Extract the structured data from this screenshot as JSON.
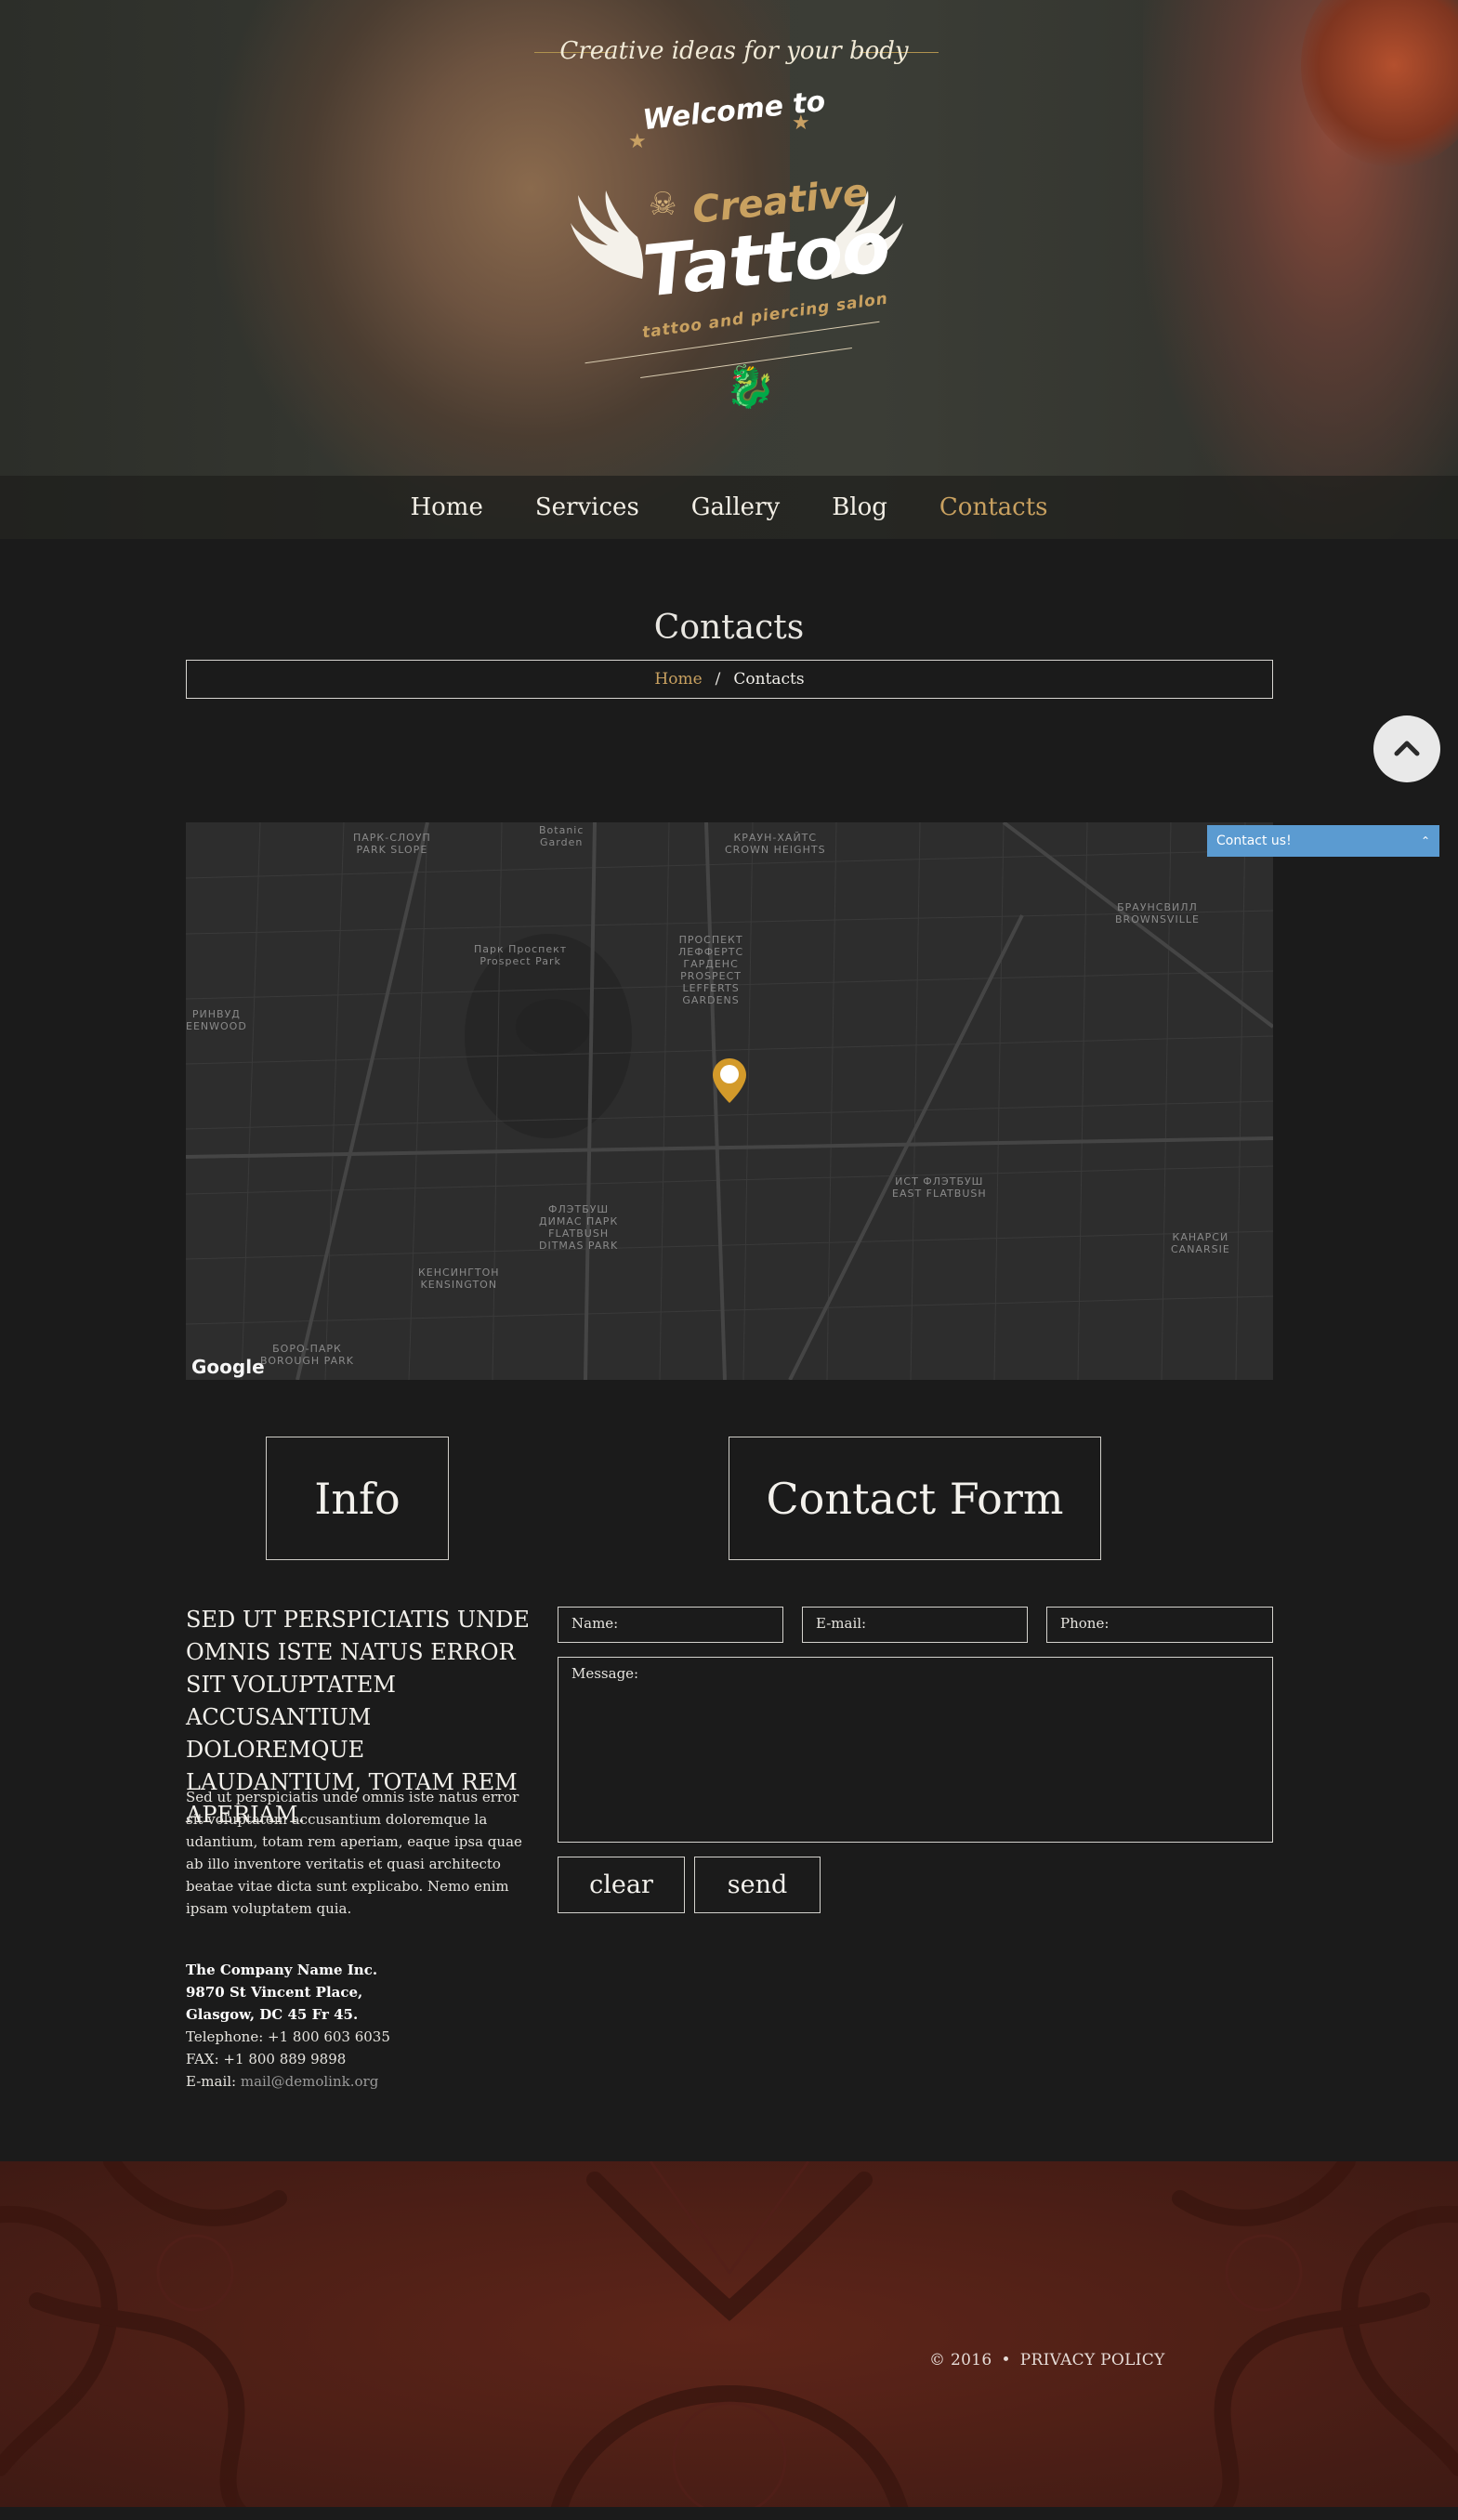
{
  "header": {
    "tagline": "Creative ideas for your body",
    "welcome": "Welcome to",
    "logo": {
      "creative": "Creative",
      "tattoo": "Tattoo",
      "subtitle": "tattoo and piercing salon"
    }
  },
  "nav": {
    "items": [
      {
        "label": "Home",
        "active": false
      },
      {
        "label": "Services",
        "active": false
      },
      {
        "label": "Gallery",
        "active": false
      },
      {
        "label": "Blog",
        "active": false
      },
      {
        "label": "Contacts",
        "active": true
      }
    ]
  },
  "page": {
    "title": "Contacts",
    "breadcrumb": {
      "home": "Home",
      "separator": "/",
      "current": "Contacts"
    }
  },
  "widgets": {
    "contact_us": "Contact us!"
  },
  "map": {
    "brand": "Google",
    "labels": [
      "ПАРК-СЛОУП\nPARK SLOPE",
      "Botanic\nGarden",
      "КРАУН-ХАЙТС\nCROWN HEIGHTS",
      "БРАУНСВИЛЛ\nBROWNSVILLE",
      "Парк Проспект\nProspect Park",
      "ПРОСПЕКТ\nЛЕФФЕРТС\nГАРДЕНС\nPROSPECT\nLEFFERTS\nGARDENS",
      "РИНВУД\nEENWOOD",
      "ФЛЭТБУШ\nДИМАС ПАРК\nFLATBUSH\nDITMAS PARK",
      "ИСТ ФЛЭТБУШ\nEAST FLATBUSH",
      "КАНАРСИ\nCANARSIE",
      "КЕНСИНГТОН\nKENSINGTON",
      "БОРО-ПАРК\nBOROUGH PARK"
    ]
  },
  "sections": {
    "info_heading": "Info",
    "form_heading": "Contact Form"
  },
  "info": {
    "lead": "SED UT PERSPICIATIS UNDE OMNIS ISTE NATUS ERROR SIT VOLUPTATEM ACCUSANTIUM DOLOREMQUE LAUDANTIUM, TOTAM REM APERIAM.",
    "body": "Sed ut perspiciatis unde omnis iste natus error sit voluptatem accusantium doloremque la udantium, totam rem aperiam, eaque ipsa quae ab illo inventore veritatis et quasi architecto beatae vitae dicta sunt explicabo. Nemo enim ipsam voluptatem quia.",
    "company": "The Company Name Inc.",
    "street": "9870 St Vincent Place,",
    "city": "Glasgow, DC 45 Fr 45.",
    "telephone": "Telephone: +1 800 603 6035",
    "fax": "FAX: +1 800 889 9898",
    "email_label": "E-mail: ",
    "email": "mail@demolink.org"
  },
  "form": {
    "name_placeholder": "Name:",
    "email_placeholder": "E-mail:",
    "phone_placeholder": "Phone:",
    "message_placeholder": "Message:",
    "clear": "clear",
    "send": "send"
  },
  "footer": {
    "copyright": "© 2016",
    "separator": "•",
    "privacy": "PRIVACY POLICY"
  },
  "colors": {
    "accent_gold": "#c9a160",
    "background": "#1b1b1b",
    "footer_red": "#4d1f16",
    "contact_widget": "#5b9bd1"
  }
}
